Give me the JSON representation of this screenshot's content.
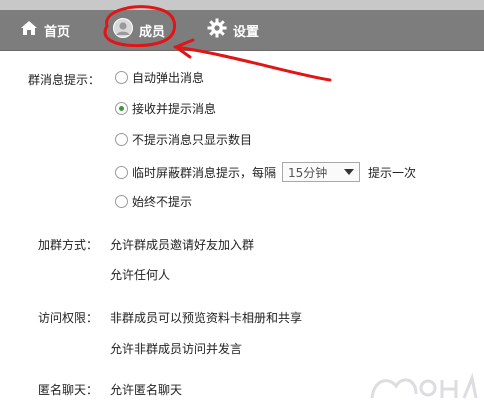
{
  "nav": {
    "home_label": "首页",
    "members_label": "成员",
    "settings_label": "设置"
  },
  "settings": {
    "group_msg_label": "群消息提示：",
    "options": [
      "自动弹出消息",
      "接收并提示消息",
      "不提示消息只显示数目",
      "临时屏蔽群消息提示，每隔",
      "始终不提示"
    ],
    "selected_option": "接收并提示消息",
    "interval_value": "15分钟",
    "interval_suffix": "提示一次",
    "join_label": "加群方式：",
    "join_options": [
      "允许群成员邀请好友加入群",
      "允许任何人"
    ],
    "access_label": "访问权限：",
    "access_options": [
      "非群成员可以预览资料卡相册和共享",
      "允许非群成员访问并发言"
    ],
    "anon_label": "匿名聊天：",
    "anon_option": "允许匿名聊天"
  },
  "annotation_color": "#e01515",
  "accent_color": "#3a9a3a"
}
